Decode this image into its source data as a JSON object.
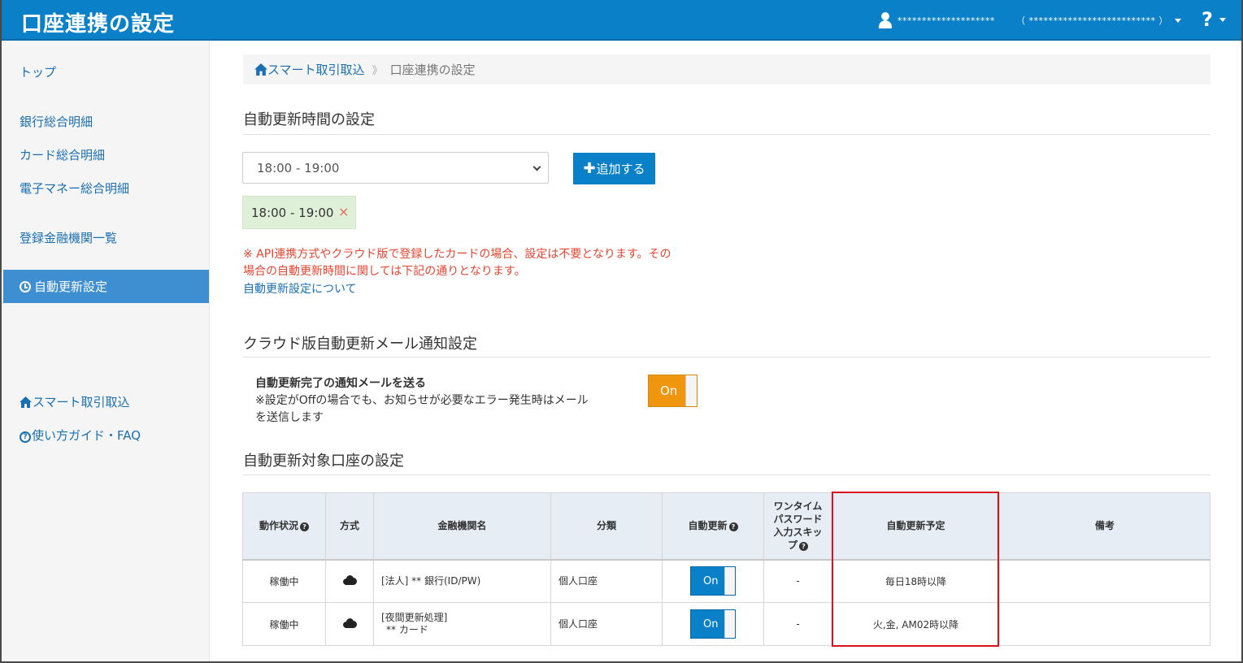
{
  "header": {
    "title": "口座連携の設定",
    "user_name": "********************",
    "org_name": "（ ************************** ）",
    "help_label": "?"
  },
  "sidebar": {
    "items": [
      {
        "label": "トップ"
      },
      {
        "label": "銀行総合明細"
      },
      {
        "label": "カード総合明細"
      },
      {
        "label": "電子マネー総合明細"
      },
      {
        "label": "登録金融機関一覧"
      },
      {
        "label": "自動更新設定",
        "active": true
      }
    ],
    "bottom_links": [
      {
        "label": "スマート取引取込",
        "icon": "home-icon"
      },
      {
        "label": "使い方ガイド・FAQ",
        "icon": "question-circle-icon"
      }
    ]
  },
  "breadcrumb": {
    "parent": "スマート取引取込",
    "separator": "》",
    "current": "口座連携の設定"
  },
  "auto_update_time": {
    "title": "自動更新時間の設定",
    "select_value": "18:00 - 19:00",
    "add_button": "追加する",
    "chips": [
      "18:00 - 19:00"
    ],
    "chip_remove": "×",
    "note_line1": "※ API連携方式やクラウド版で登録したカードの場合、設定は不要となります。その",
    "note_line2": "場合の自動更新時間に関しては下記の通りとなります。",
    "link": "自動更新設定について"
  },
  "mail_settings": {
    "title": "クラウド版自動更新メール通知設定",
    "label": "自動更新完了の通知メールを送る",
    "note_line1": "※設定がOffの場合でも、お知らせが必要なエラー発生時はメール",
    "note_line2": "を送信します",
    "toggle": "On"
  },
  "accounts": {
    "title": "自動更新対象口座の設定",
    "headers": {
      "status": "動作状況",
      "method": "方式",
      "institution": "金融機関名",
      "category": "分類",
      "auto_update": "自動更新",
      "otp_line1": "ワンタイム",
      "otp_line2": "パスワード",
      "otp_line3": "入力スキッ",
      "otp_line4": "プ",
      "schedule": "自動更新予定",
      "remarks": "備考"
    },
    "rows": [
      {
        "status": "稼働中",
        "method_icon": "cloud-icon",
        "inst_line1": "[法人] ** 銀行(ID/PW)",
        "inst_line2": "",
        "category": "個人口座",
        "toggle": "On",
        "otp": "-",
        "schedule": "毎日18時以降",
        "remarks": ""
      },
      {
        "status": "稼働中",
        "method_icon": "cloud-icon",
        "inst_line1": "[夜間更新処理]",
        "inst_line2": "** カード",
        "category": "個人口座",
        "toggle": "On",
        "otp": "-",
        "schedule": "火,金, AM02時以降",
        "remarks": ""
      }
    ]
  },
  "colors": {
    "header": "#0a80c8",
    "sidebar_active": "#3d8fd1",
    "link": "#1a6fb2",
    "warning_text": "#e5452f",
    "mail_toggle": "#f0960e",
    "chip_bg": "#dff0d8",
    "highlight": "#d9121b"
  }
}
